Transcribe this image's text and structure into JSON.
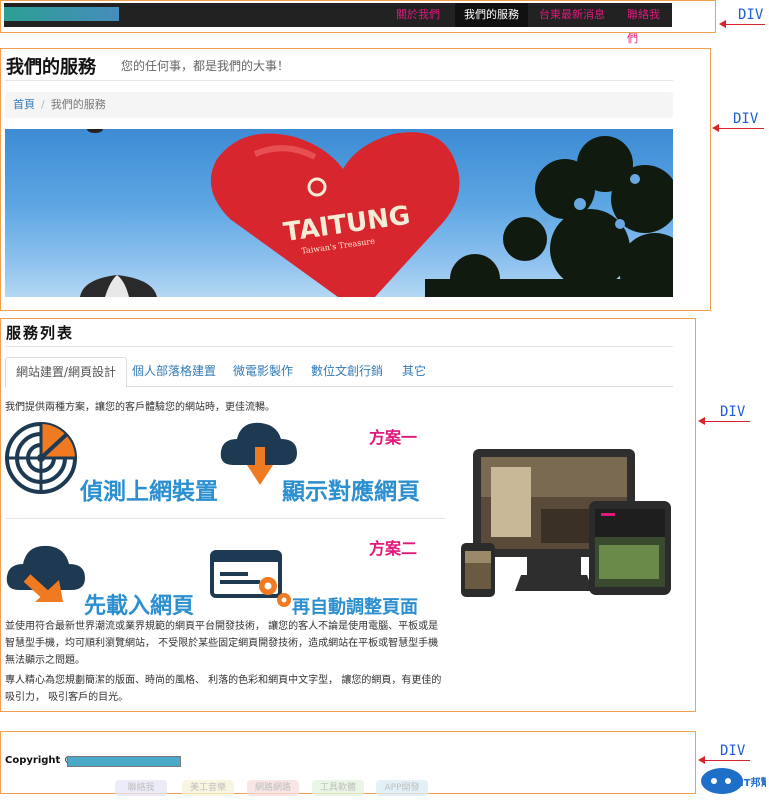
{
  "nav": {
    "items": [
      "關於我們",
      "我們的服務",
      "台東最新消息",
      "聯絡我們"
    ],
    "active_index": 1
  },
  "header": {
    "title": "我們的服務",
    "subtitle": "您的任何事，都是我們的大事！",
    "breadcrumb": {
      "home": "首頁",
      "separator": "/",
      "current": "我們的服務"
    },
    "hero_logo_text": "TAITUNG",
    "hero_logo_tagline": "Taiwan's Treasure"
  },
  "services": {
    "title": "服務列表",
    "tabs": [
      "網站建置/網頁設計",
      "個人部落格建置",
      "微電影製作",
      "數位文創行銷",
      "其它"
    ],
    "active_tab": 0,
    "intro": "我們提供兩種方案，讓您的客戶體驗您的網站時，更佳流暢。",
    "plan1": {
      "label": "方案一",
      "step1": "偵測上網裝置",
      "step2": "顯示對應網頁"
    },
    "plan2": {
      "label": "方案二",
      "step1": "先載入網頁",
      "step2": "再自動調整頁面"
    },
    "paragraph1": "並使用符合最新世界潮流或業界規範的網頁平台開發技術， 讓您的客人不論是使用電腦、平板或是智慧型手機，均可順利瀏覽網站， 不受限於某些固定網頁開發技術，造成網站在平板或智慧型手機無法顯示之問題。",
    "paragraph2": "專人精心為您規劃簡潔的版面、時尚的風格、 利落的色彩和網頁中文字型， 讓您的網頁，有更佳的吸引力， 吸引客戶的目光。"
  },
  "footer": {
    "copyright": "Copyright ©",
    "links": [
      "聯絡我",
      "美工音樂",
      "網路網路",
      "工具軟體",
      "APP開發"
    ],
    "badge": "IT邦幫忙"
  },
  "annotations": {
    "div_label": "DIV"
  },
  "colors": {
    "nav_bg": "#222222",
    "nav_link": "#e0197d",
    "box_outline": "#f0a050",
    "annotation": "#1f5fd0",
    "arrow": "#d9232c",
    "accent_blue": "#2b8fd0"
  }
}
